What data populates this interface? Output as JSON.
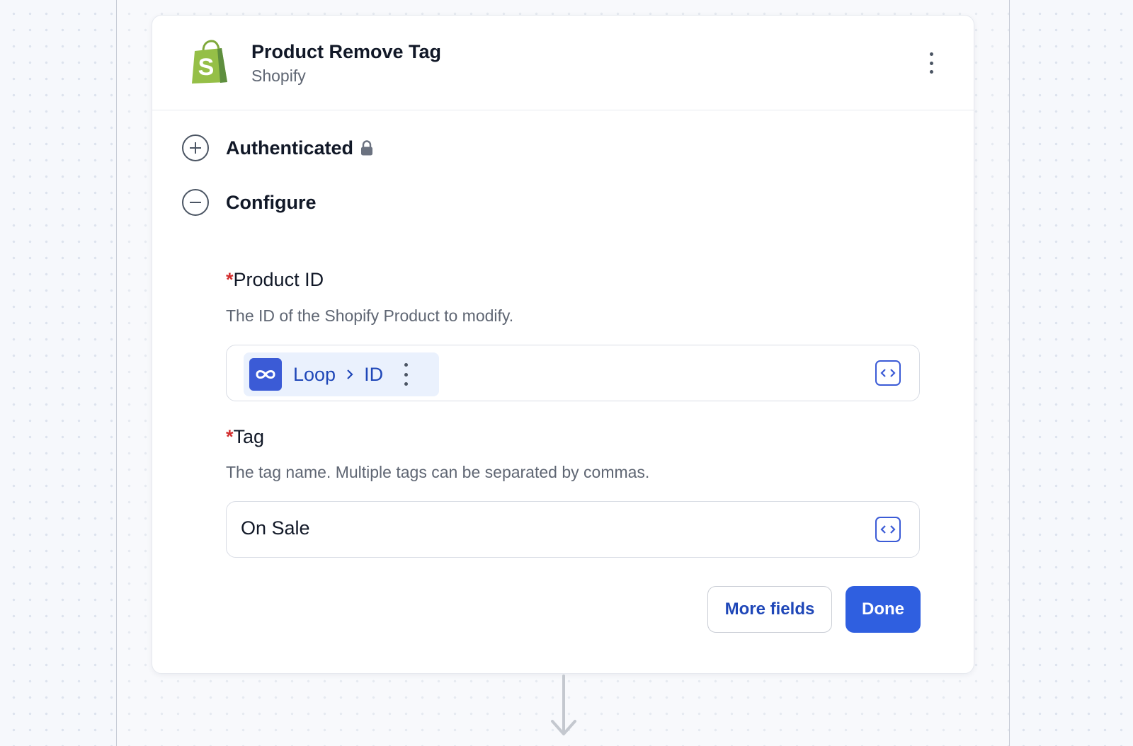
{
  "step": {
    "title": "Product Remove Tag",
    "app_name": "Shopify",
    "app_icon": "shopify-bag-icon",
    "menu_icon": "more-vertical-icon"
  },
  "sections": {
    "authenticated": {
      "label": "Authenticated",
      "icon": "plus-circle-icon",
      "status_icon": "lock-icon"
    },
    "configure": {
      "label": "Configure",
      "icon": "minus-circle-icon"
    }
  },
  "fields": {
    "product_id": {
      "required_marker": "*",
      "label": "Product ID",
      "description": "The ID of the Shopify Product to modify.",
      "token": {
        "source": "Loop",
        "separator_icon": "chevron-right-icon",
        "key": "ID",
        "icon": "infinity-icon"
      }
    },
    "tag": {
      "required_marker": "*",
      "label": "Tag",
      "description": "The tag name. Multiple tags can be separated by commas.",
      "value": "On Sale"
    }
  },
  "actions": {
    "more_fields_label": "More fields",
    "done_label": "Done"
  },
  "colors": {
    "accent": "#2f5fe0",
    "link_text": "#1f47b8",
    "required": "#d32f2f",
    "shopify_green": "#95bf47"
  }
}
